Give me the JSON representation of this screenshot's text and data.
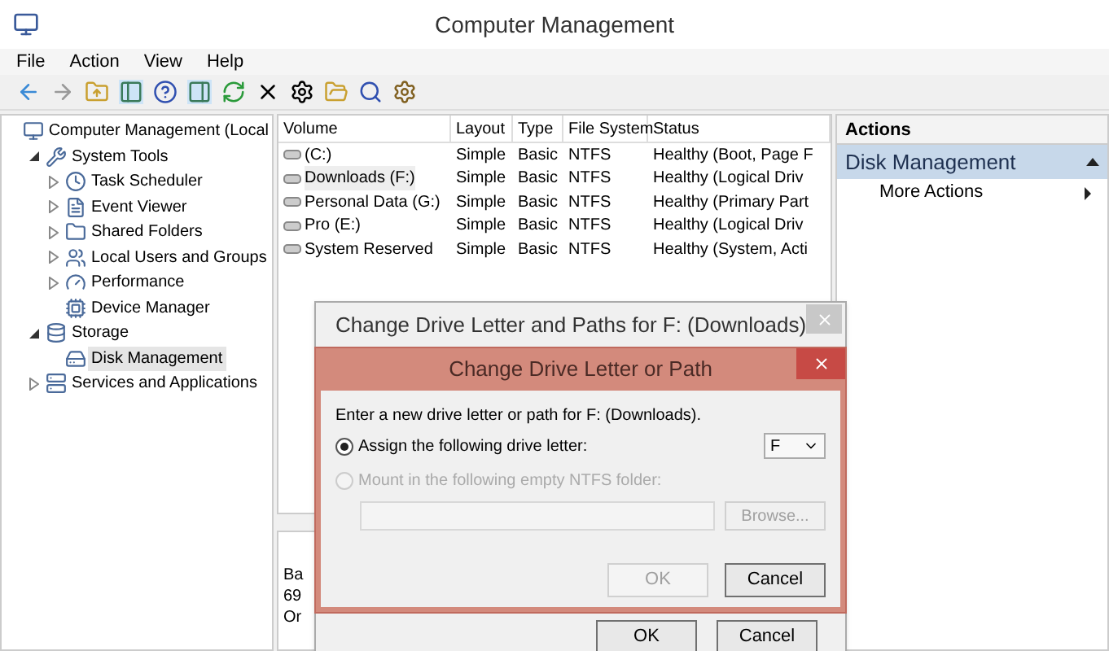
{
  "window": {
    "title": "Computer Management"
  },
  "menu": [
    "File",
    "Action",
    "View",
    "Help"
  ],
  "tree": [
    {
      "label": "Computer Management (Local",
      "selected": false,
      "children": [
        {
          "label": "System Tools",
          "expanded": true,
          "selected": false,
          "children": [
            {
              "label": "Task Scheduler",
              "expanded": false,
              "selected": false
            },
            {
              "label": "Event Viewer",
              "expanded": false,
              "selected": false
            },
            {
              "label": "Shared Folders",
              "expanded": false,
              "selected": false
            },
            {
              "label": "Local Users and Groups",
              "expanded": false,
              "selected": false
            },
            {
              "label": "Performance",
              "expanded": false,
              "selected": false
            },
            {
              "label": "Device Manager",
              "selected": false
            }
          ]
        },
        {
          "label": "Storage",
          "expanded": true,
          "selected": false,
          "children": [
            {
              "label": "Disk Management",
              "selected": true
            }
          ]
        },
        {
          "label": "Services and Applications",
          "expanded": false,
          "selected": false
        }
      ]
    }
  ],
  "table": {
    "columns": [
      "Volume",
      "Layout",
      "Type",
      "File System",
      "Status"
    ],
    "rows": [
      {
        "cells": [
          "(C:)",
          "Simple",
          "Basic",
          "NTFS",
          "Healthy (Boot, Page F"
        ],
        "selected": false
      },
      {
        "cells": [
          "Downloads (F:)",
          "Simple",
          "Basic",
          "NTFS",
          "Healthy (Logical Driv"
        ],
        "selected": true
      },
      {
        "cells": [
          "Personal Data (G:)",
          "Simple",
          "Basic",
          "NTFS",
          "Healthy (Primary Part"
        ],
        "selected": false
      },
      {
        "cells": [
          "Pro (E:)",
          "Simple",
          "Basic",
          "NTFS",
          "Healthy (Logical Driv"
        ],
        "selected": false
      },
      {
        "cells": [
          "System Reserved",
          "Simple",
          "Basic",
          "NTFS",
          "Healthy (System, Acti"
        ],
        "selected": false
      }
    ]
  },
  "disk_pane": {
    "lines": [
      "Ba",
      "69",
      "Or"
    ]
  },
  "actions": {
    "title": "Actions",
    "section": "Disk Management",
    "items": [
      "More Actions"
    ]
  },
  "outer_dialog": {
    "title": "Change Drive Letter and Paths for F: (Downloads)",
    "buttons": [
      "OK",
      "Cancel"
    ]
  },
  "inner_dialog": {
    "title": "Change Drive Letter or Path",
    "prompt": "Enter a new drive letter or path for F: (Downloads).",
    "options": [
      {
        "label": "Assign the following drive letter:",
        "selected": true,
        "disabled": false
      },
      {
        "label": "Mount in the following empty NTFS folder:",
        "selected": false,
        "disabled": true
      }
    ],
    "drive_letter": "F",
    "browse": {
      "label": "Browse...",
      "disabled": true
    },
    "buttons": [
      {
        "label": "OK",
        "disabled": true
      },
      {
        "label": "Cancel",
        "disabled": false
      }
    ]
  }
}
